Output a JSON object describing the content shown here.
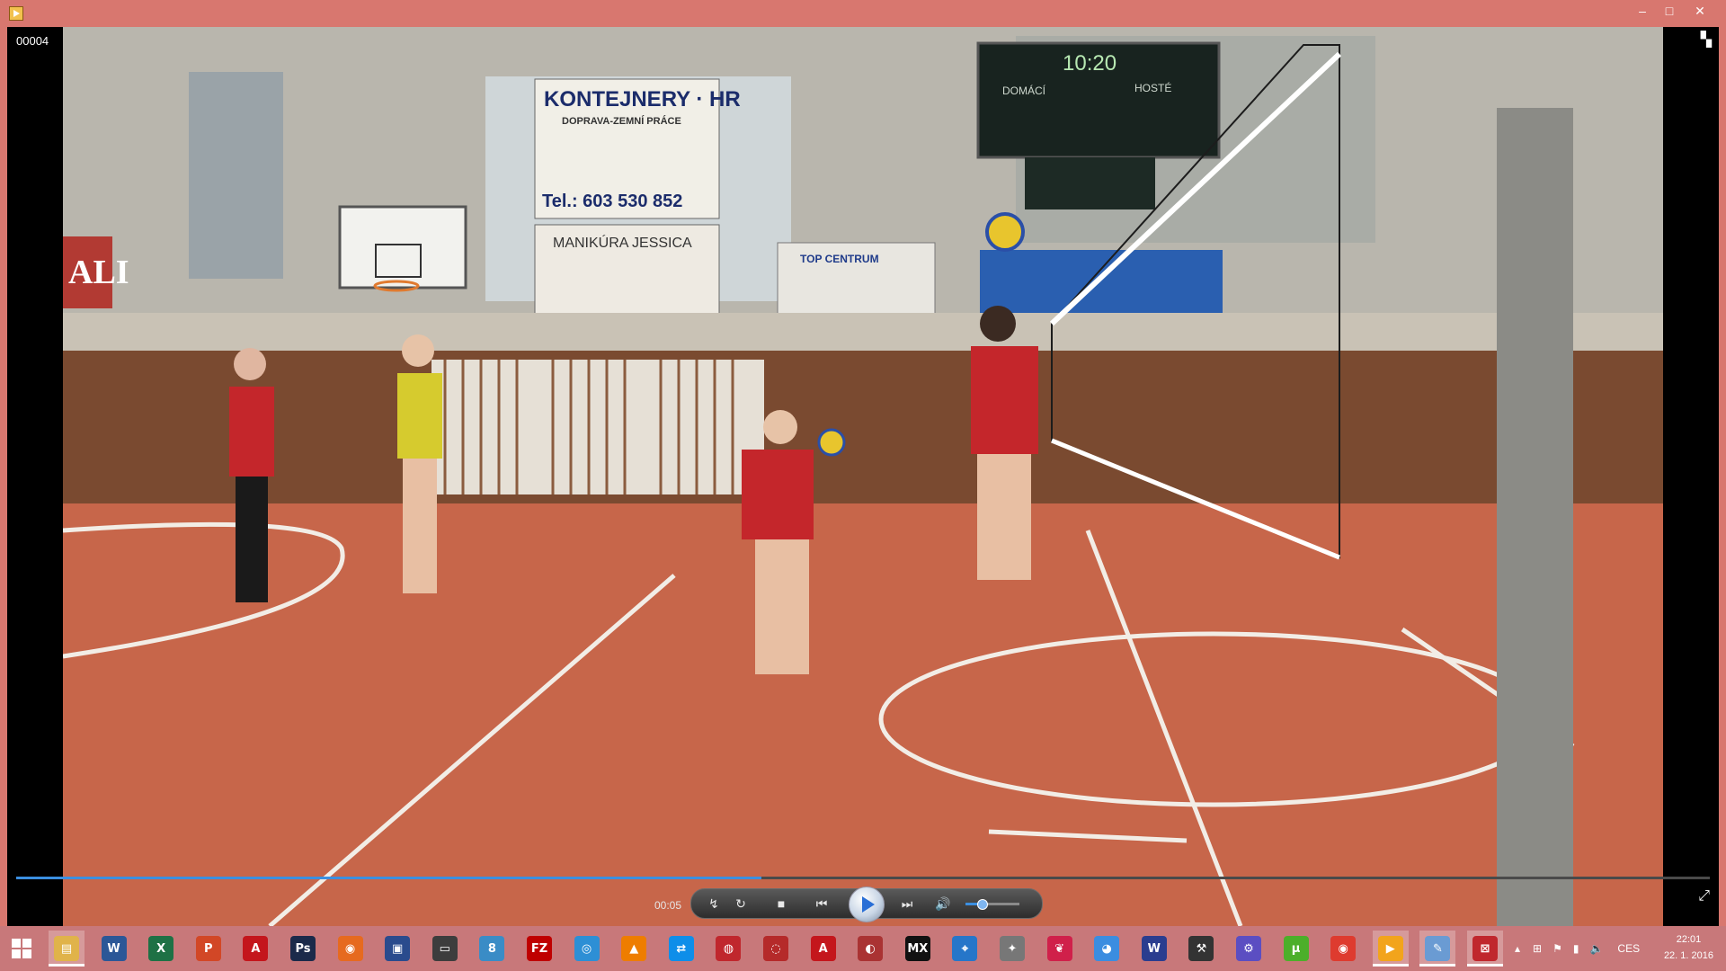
{
  "window": {
    "buttons": {
      "minimize": "–",
      "maximize": "□",
      "close": "✕"
    }
  },
  "player": {
    "file_label": "00004",
    "current_time": "00:05",
    "progress": 0.44,
    "volume": 0.3
  },
  "video_scene": {
    "banner_1_line_1": "KONTEJNERY · HR",
    "banner_1_line_2": "DOPRAVA-ZEMNÍ PRÁCE",
    "banner_1_phone": "Tel.: 603 530 852",
    "banner_2": "MANIKÚRA JESSICA",
    "banner_3": "TOP CENTRUM",
    "scoreboard_time": "10:20",
    "scoreboard_home": "DOMÁCÍ",
    "scoreboard_away": "HOSTÉ",
    "sign_left": "ALI"
  },
  "controls": {
    "shuffle_icon": "↯",
    "repeat_icon": "↻",
    "stop_icon": "■",
    "prev_icon": "⏮",
    "next_icon": "⏭",
    "volume_icon": "🔊"
  },
  "taskbar": {
    "start_icon": "windows-logo",
    "apps": [
      {
        "name": "file-explorer",
        "glyph": "▤",
        "color": "#e0b34a"
      },
      {
        "name": "word",
        "glyph": "W",
        "color": "#2b5797"
      },
      {
        "name": "excel",
        "glyph": "X",
        "color": "#1e7145"
      },
      {
        "name": "powerpoint",
        "glyph": "P",
        "color": "#d24726"
      },
      {
        "name": "acrobat",
        "glyph": "A",
        "color": "#c4161c"
      },
      {
        "name": "photoshop",
        "glyph": "Ps",
        "color": "#1b2a4a"
      },
      {
        "name": "firefox",
        "glyph": "◉",
        "color": "#e66a1f"
      },
      {
        "name": "save-tool",
        "glyph": "▣",
        "color": "#2a4b8d"
      },
      {
        "name": "monitor-app",
        "glyph": "▭",
        "color": "#3d3d3d"
      },
      {
        "name": "app-8",
        "glyph": "8",
        "color": "#3a8cc6"
      },
      {
        "name": "filezilla",
        "glyph": "FZ",
        "color": "#bf0000"
      },
      {
        "name": "globe-app",
        "glyph": "◎",
        "color": "#2d8fd5"
      },
      {
        "name": "vlc",
        "glyph": "▲",
        "color": "#ee7d00"
      },
      {
        "name": "teamviewer",
        "glyph": "⇄",
        "color": "#0e8ee9"
      },
      {
        "name": "volleyball-app",
        "glyph": "◍",
        "color": "#c0272d"
      },
      {
        "name": "circle-app",
        "glyph": "◌",
        "color": "#b52a2a"
      },
      {
        "name": "pdf-app",
        "glyph": "A",
        "color": "#c4161c"
      },
      {
        "name": "media-app",
        "glyph": "◐",
        "color": "#a33"
      },
      {
        "name": "mx-player",
        "glyph": "MX",
        "color": "#111"
      },
      {
        "name": "network-app",
        "glyph": "⌖",
        "color": "#2676c9"
      },
      {
        "name": "pin-app",
        "glyph": "✦",
        "color": "#777"
      },
      {
        "name": "lips-app",
        "glyph": "❦",
        "color": "#d0204a"
      },
      {
        "name": "earth-app",
        "glyph": "◕",
        "color": "#3b8de0"
      },
      {
        "name": "winamp",
        "glyph": "W",
        "color": "#2a3d8f"
      },
      {
        "name": "tools-app",
        "glyph": "⚒",
        "color": "#333"
      },
      {
        "name": "settings-app",
        "glyph": "⚙",
        "color": "#5b4ec2"
      },
      {
        "name": "utorrent",
        "glyph": "µ",
        "color": "#4caf2a"
      },
      {
        "name": "chrome",
        "glyph": "◉",
        "color": "#de3b2f"
      },
      {
        "name": "media-player",
        "glyph": "▶",
        "color": "#f2a41c"
      },
      {
        "name": "paint-app",
        "glyph": "✎",
        "color": "#6a9bd3"
      },
      {
        "name": "red-app",
        "glyph": "⊠",
        "color": "#c0272d"
      }
    ],
    "language": "CES",
    "time": "22:01",
    "date": "22. 1. 2016"
  }
}
